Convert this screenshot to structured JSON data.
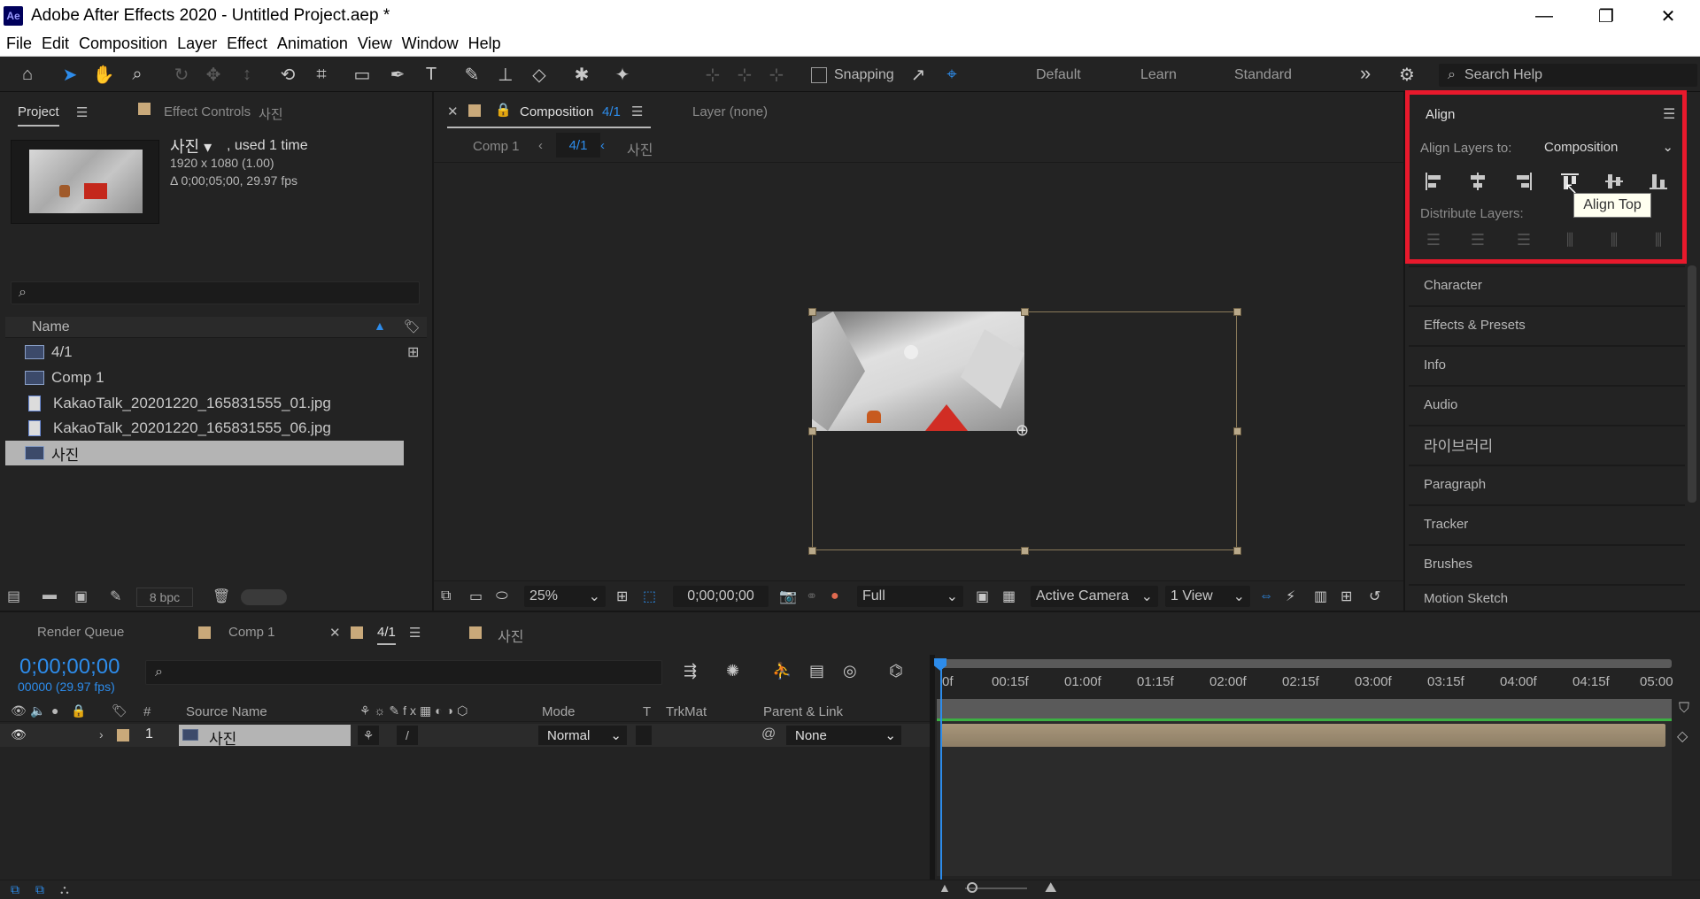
{
  "window": {
    "title": "Adobe After Effects 2020 - Untitled Project.aep *",
    "logo_text": "Ae",
    "minimize": "—",
    "restore": "❐",
    "close": "✕"
  },
  "menu": [
    "File",
    "Edit",
    "Composition",
    "Layer",
    "Effect",
    "Animation",
    "View",
    "Window",
    "Help"
  ],
  "toolbar": {
    "snapping_label": "Snapping",
    "workspaces": [
      "Default",
      "Learn",
      "Standard"
    ],
    "overflow": "»",
    "search_placeholder": "Search Help"
  },
  "project": {
    "tab_label": "Project",
    "effect_controls_label": "Effect Controls",
    "effect_controls_target": "사진",
    "selected_name": "사진 ▾",
    "used_text": ", used 1 time",
    "dimensions": "1920 x 1080 (1.00)",
    "duration": "Δ 0;00;05;00, 29.97 fps",
    "name_header": "Name",
    "items": [
      {
        "name": "4/1",
        "type": "comp"
      },
      {
        "name": "Comp 1",
        "type": "comp"
      },
      {
        "name": "KakaoTalk_20201220_165831555_01.jpg",
        "type": "jpg"
      },
      {
        "name": "KakaoTalk_20201220_165831555_06.jpg",
        "type": "jpg"
      },
      {
        "name": "사진",
        "type": "comp"
      }
    ],
    "bpc": "8 bpc"
  },
  "composition": {
    "tab_prefix": "Composition",
    "tab_name": "4/1",
    "layer_tab": "Layer (none)",
    "breadcrumbs": [
      "Comp 1",
      "4/1",
      "사진"
    ],
    "zoom": "25%",
    "timecode": "0;00;00;00",
    "resolution": "Full",
    "camera": "Active Camera",
    "views": "1 View"
  },
  "align": {
    "title": "Align",
    "align_to_label": "Align Layers to:",
    "align_to_value": "Composition",
    "distribute_label": "Distribute Layers:",
    "tooltip": "Align Top"
  },
  "right_panels": [
    "Character",
    "Effects & Presets",
    "Info",
    "Audio",
    "라이브러리",
    "Paragraph",
    "Tracker",
    "Brushes",
    "Motion Sketch"
  ],
  "timeline": {
    "tabs": [
      "Render Queue",
      "Comp 1",
      "4/1",
      "사진"
    ],
    "timecode": "0;00;00;00",
    "frame_info": "00000 (29.97 fps)",
    "columns": {
      "number": "#",
      "source": "Source Name",
      "mode": "Mode",
      "t": "T",
      "trkmat": "TrkMat",
      "parent": "Parent & Link"
    },
    "layer": {
      "index": "1",
      "name": "사진",
      "mode": "Normal",
      "parent": "None"
    },
    "ruler": [
      "0f",
      "00:15f",
      "01:00f",
      "01:15f",
      "02:00f",
      "02:15f",
      "03:00f",
      "03:15f",
      "04:00f",
      "04:15f",
      "05:00"
    ]
  },
  "colors": {
    "accent": "#2d8ceb",
    "highlight_box": "#e8192c",
    "panel_bg": "#232323"
  }
}
